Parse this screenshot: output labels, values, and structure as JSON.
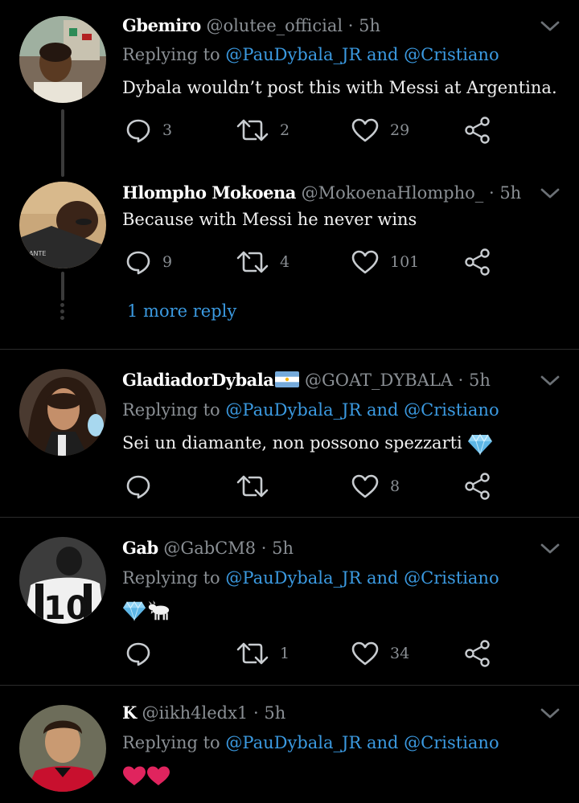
{
  "tweets": [
    {
      "name": "Gbemiro",
      "handle": "@olutee_official",
      "time": "5h",
      "replying_prefix": "Replying to",
      "mention1": "@PauDybala_JR",
      "and": "and",
      "mention2": "@Cristiano",
      "text": "Dybala wouldn’t post this with Messi at Argentina.",
      "replies": "3",
      "retweets": "2",
      "likes": "29"
    },
    {
      "name": "Hlompho Mokoena",
      "handle": "@MokoenaHlompho_",
      "time": "5h",
      "text": "Because with Messi he never wins",
      "replies": "9",
      "retweets": "4",
      "likes": "101"
    },
    {
      "name": "GladiadorDybala",
      "handle": "@GOAT_DYBALA",
      "time": "5h",
      "replying_prefix": "Replying to",
      "mention1": "@PauDybala_JR",
      "and": "and",
      "mention2": "@Cristiano",
      "text": "Sei un diamante, non possono spezzarti",
      "likes": "8"
    },
    {
      "name": "Gab",
      "handle": "@GabCM8",
      "time": "5h",
      "replying_prefix": "Replying to",
      "mention1": "@PauDybala_JR",
      "and": "and",
      "mention2": "@Cristiano",
      "retweets": "1",
      "likes": "34"
    },
    {
      "name": "K",
      "handle": "@iikh4ledx1",
      "time": "5h",
      "replying_prefix": "Replying to",
      "mention1": "@PauDybala_JR",
      "and": "and",
      "mention2": "@Cristiano"
    }
  ],
  "more_reply": "1 more reply",
  "separator": "·",
  "colors": {
    "background": "#000000",
    "link": "#3b9ae1",
    "muted": "#8a8f94",
    "divider": "#2b2b2b"
  },
  "icons": [
    "reply-icon",
    "retweet-icon",
    "like-icon",
    "share-icon",
    "chevron-down-icon",
    "diamond-emoji",
    "goat-emoji",
    "heart-emoji",
    "argentina-flag-emoji"
  ]
}
